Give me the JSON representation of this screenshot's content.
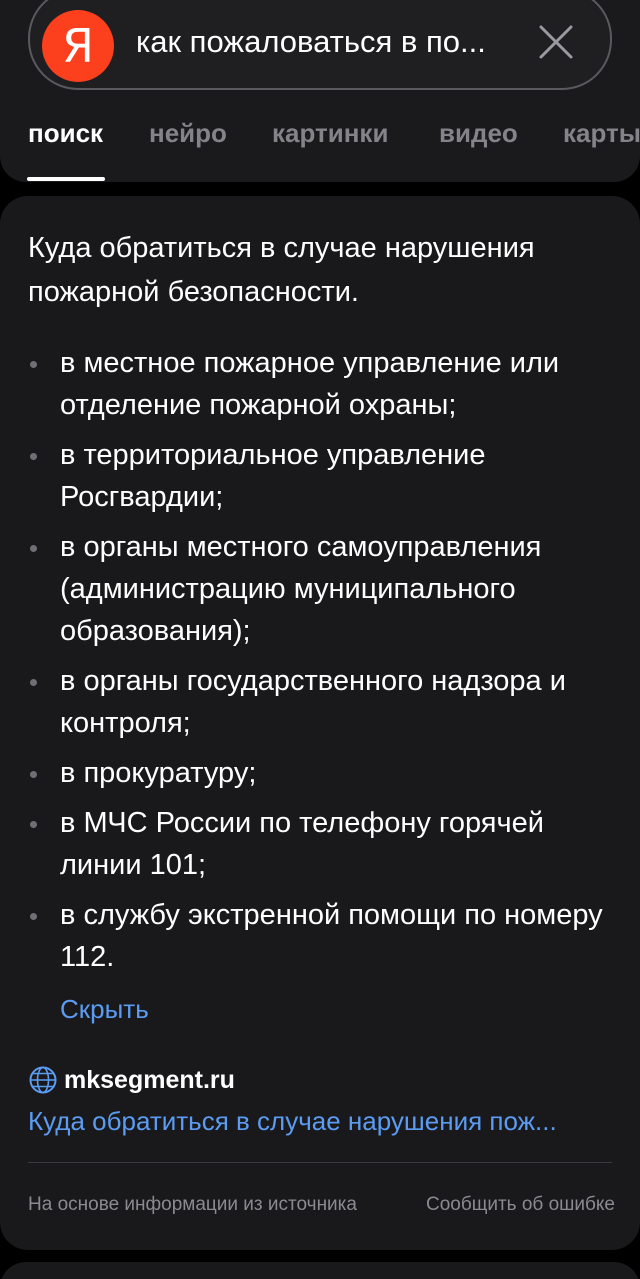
{
  "search": {
    "logo_letter": "Я",
    "query": "как пожаловаться в по..."
  },
  "tabs": [
    {
      "label": "поиск",
      "active": true
    },
    {
      "label": "нейро",
      "active": false
    },
    {
      "label": "картинки",
      "active": false
    },
    {
      "label": "видео",
      "active": false
    },
    {
      "label": "карты",
      "active": false
    }
  ],
  "answer": {
    "title": "Куда обратиться в случае нарушения пожарной безопасности.",
    "items": [
      "в местное пожарное управление или отделение пожарной охраны;",
      "в территориальное управление Росгвардии;",
      "в органы местного самоуправления (администрацию муниципального образования);",
      "в органы государственного надзора и контроля;",
      "в прокуратуру;",
      "в МЧС России по телефону горячей линии 101;",
      "в службу экстренной помощи по номеру 112."
    ],
    "hide_label": "Скрыть"
  },
  "source": {
    "icon": "globe-icon",
    "name": "mksegment.ru",
    "link_text": "Куда обратиться в случае нарушения пож..."
  },
  "footer": {
    "based_on": "На основе информации из источника",
    "report": "Сообщить об ошибке"
  },
  "colors": {
    "logo": "#fc3f1d",
    "link": "#5b9cf2",
    "card_bg": "#19191b"
  }
}
